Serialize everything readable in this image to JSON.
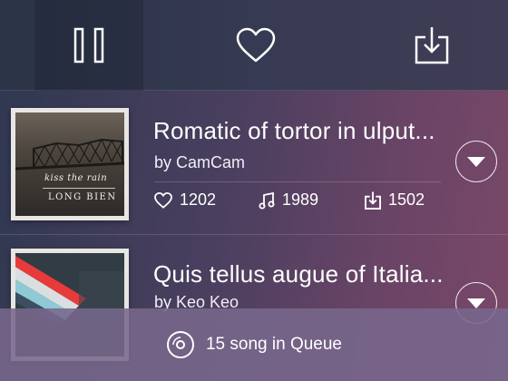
{
  "toolbar": {
    "pause_icon": "pause-icon",
    "like_icon": "heart-icon",
    "download_icon": "download-icon"
  },
  "tracks": [
    {
      "title": "Romatic of tortor in ulput...",
      "artist": "by CamCam",
      "cover_script": "kiss the rain",
      "cover_main": "LONG BIEN",
      "likes": "1202",
      "plays": "1989",
      "downloads": "1502"
    },
    {
      "title": "Quis tellus augue of Italia...",
      "artist": "by Keo Keo"
    }
  ],
  "queue": {
    "label": "15 song in Queue",
    "icon": "disc-icon"
  },
  "colors": {
    "background_start": "#2f3850",
    "background_end": "#7a4868",
    "queue_bar": "#78688c",
    "text": "#ffffff"
  }
}
